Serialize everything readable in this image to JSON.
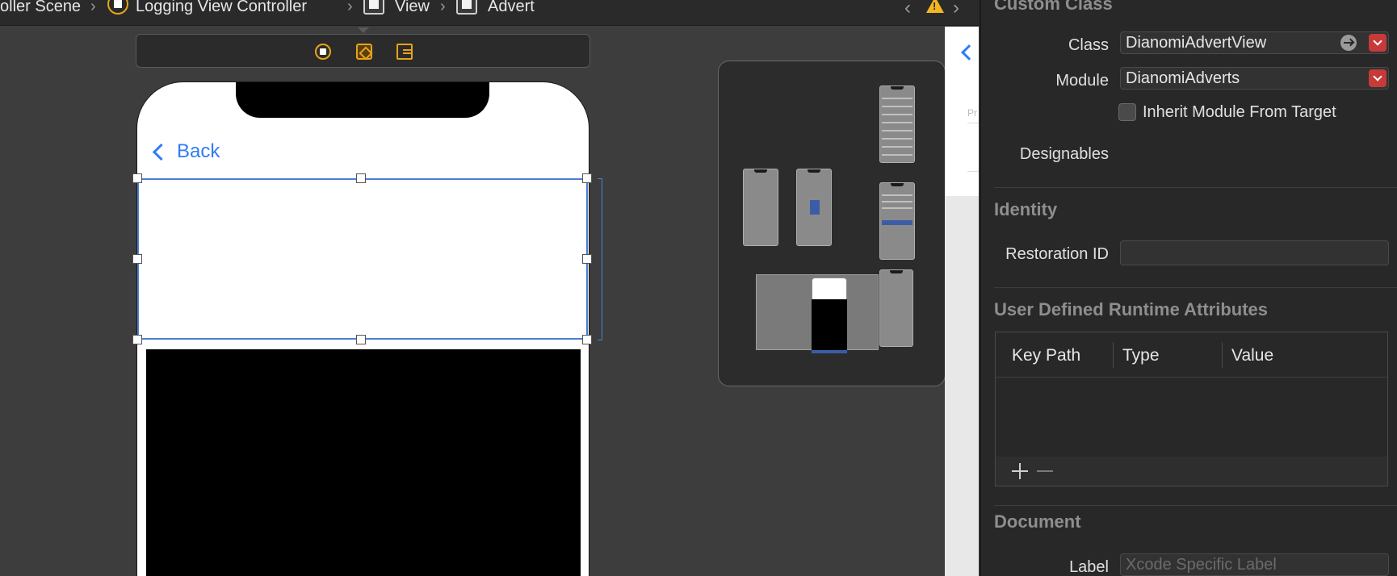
{
  "breadcrumb": {
    "items": [
      "oller Scene",
      "Logging View Controller",
      "View",
      "Advert"
    ]
  },
  "inspector": {
    "custom_class": {
      "title": "Custom Class",
      "class_label": "Class",
      "class_value": "DianomiAdvertView",
      "module_label": "Module",
      "module_value": "DianomiAdverts",
      "inherit_label": "Inherit Module From Target",
      "designables_label": "Designables"
    },
    "identity": {
      "title": "Identity",
      "restoration_label": "Restoration ID",
      "restoration_value": ""
    },
    "runtime_attributes": {
      "title": "User Defined Runtime Attributes",
      "columns": [
        "Key Path",
        "Type",
        "Value"
      ]
    },
    "document": {
      "title": "Document",
      "label_label": "Label",
      "label_placeholder": "Xcode Specific Label"
    }
  },
  "canvas": {
    "back_label": "Back",
    "preview_text": "Pr"
  },
  "colors": {
    "accent_blue": "#2f7cf6",
    "warning_yellow": "#f3b61f",
    "selection_blue": "#4b7fd1",
    "dropdown_red": "#c73a3a"
  }
}
